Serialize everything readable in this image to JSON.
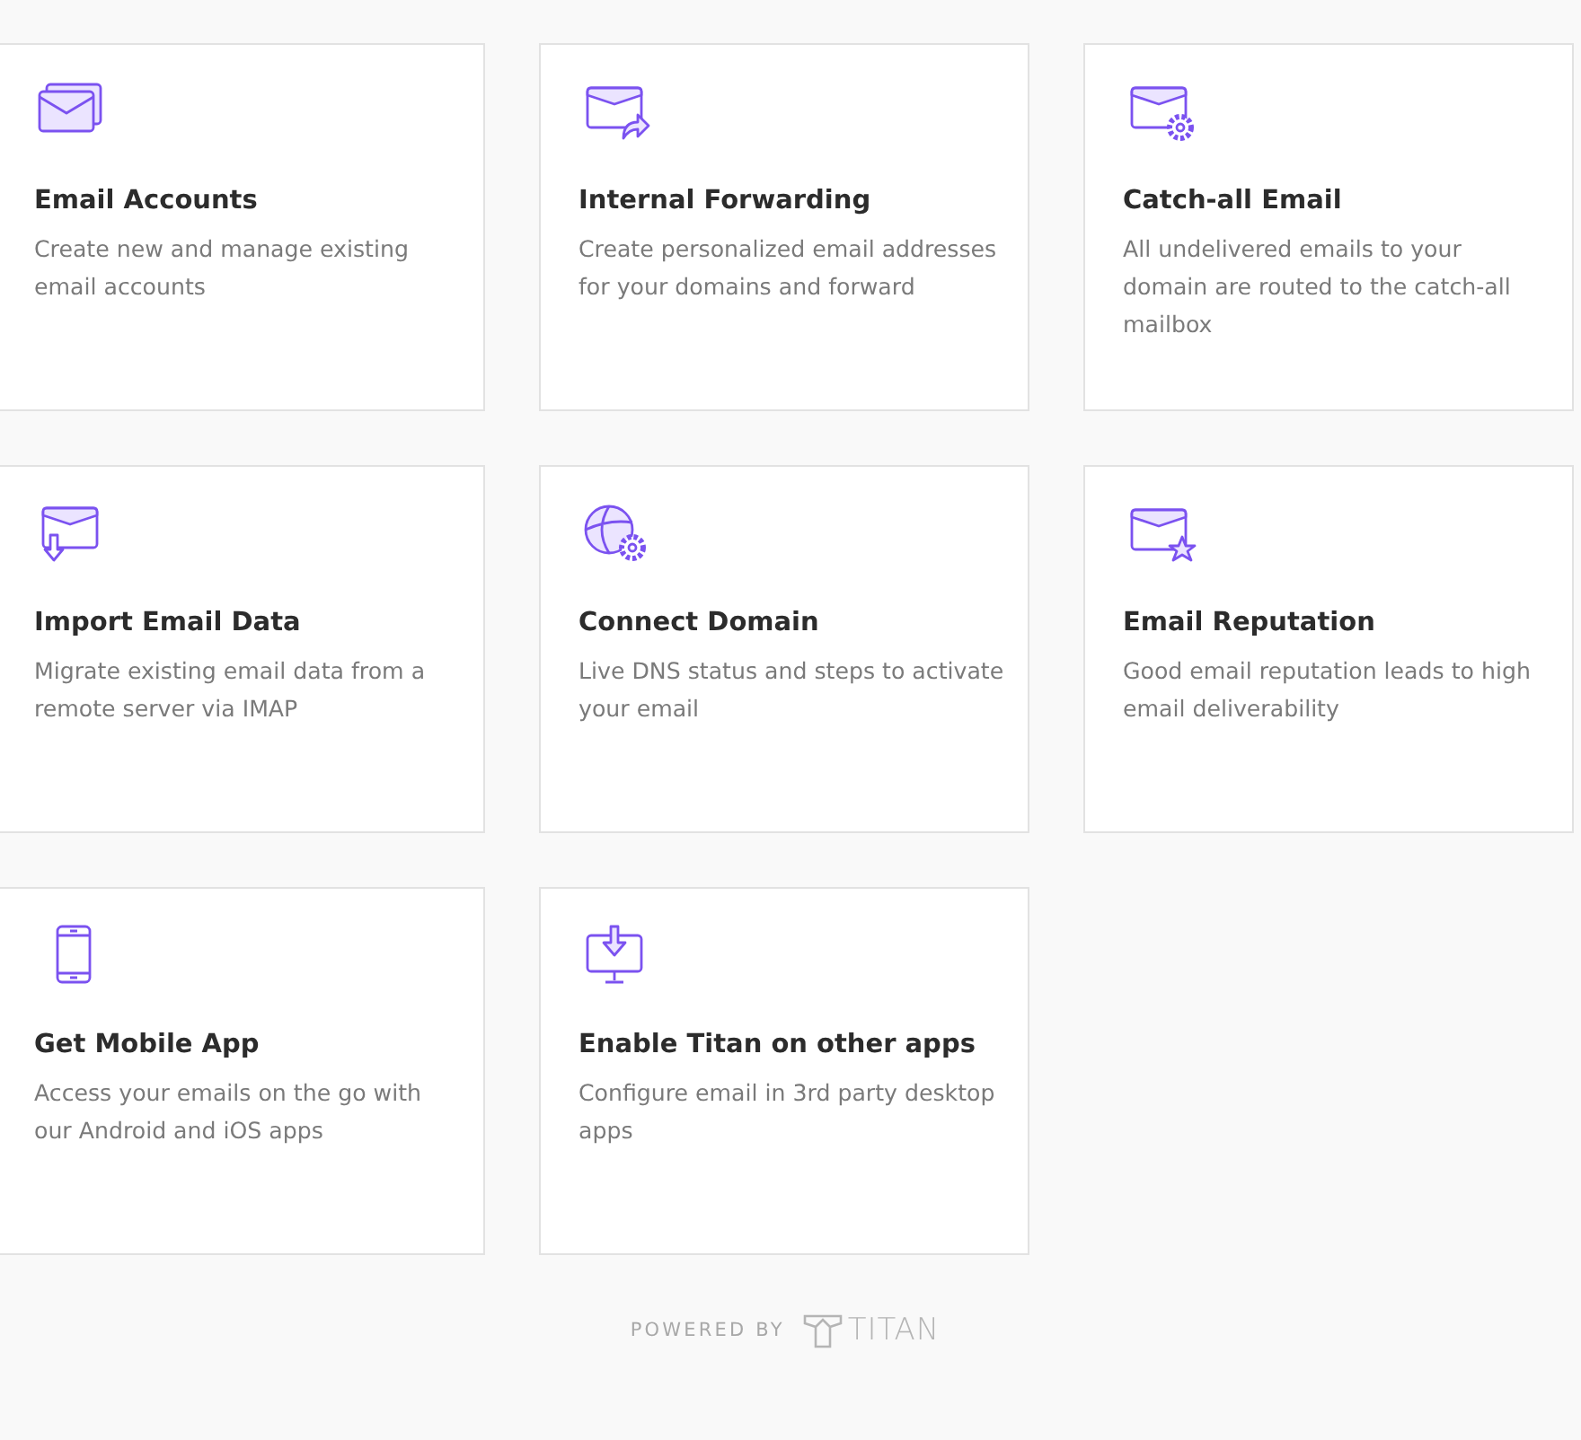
{
  "cards": [
    {
      "title": "Email Accounts",
      "description": "Create new and manage existing email accounts"
    },
    {
      "title": "Internal Forwarding",
      "description": "Create personalized email addresses for your domains and forward"
    },
    {
      "title": "Catch-all Email",
      "description": "All undelivered emails to your domain are routed to the catch-all mailbox"
    },
    {
      "title": "Import Email Data",
      "description": "Migrate existing email data from a remote server via IMAP"
    },
    {
      "title": "Connect Domain",
      "description": "Live DNS status and steps to activate your email"
    },
    {
      "title": "Email Reputation",
      "description": "Good email reputation leads to high email deliverability"
    },
    {
      "title": "Get Mobile App",
      "description": "Access your emails on the go with our Android and iOS apps"
    },
    {
      "title": "Enable Titan on other apps",
      "description": "Configure email in 3rd party desktop apps"
    }
  ],
  "footer": {
    "powered_by": "POWERED BY",
    "brand": "TITAN"
  }
}
